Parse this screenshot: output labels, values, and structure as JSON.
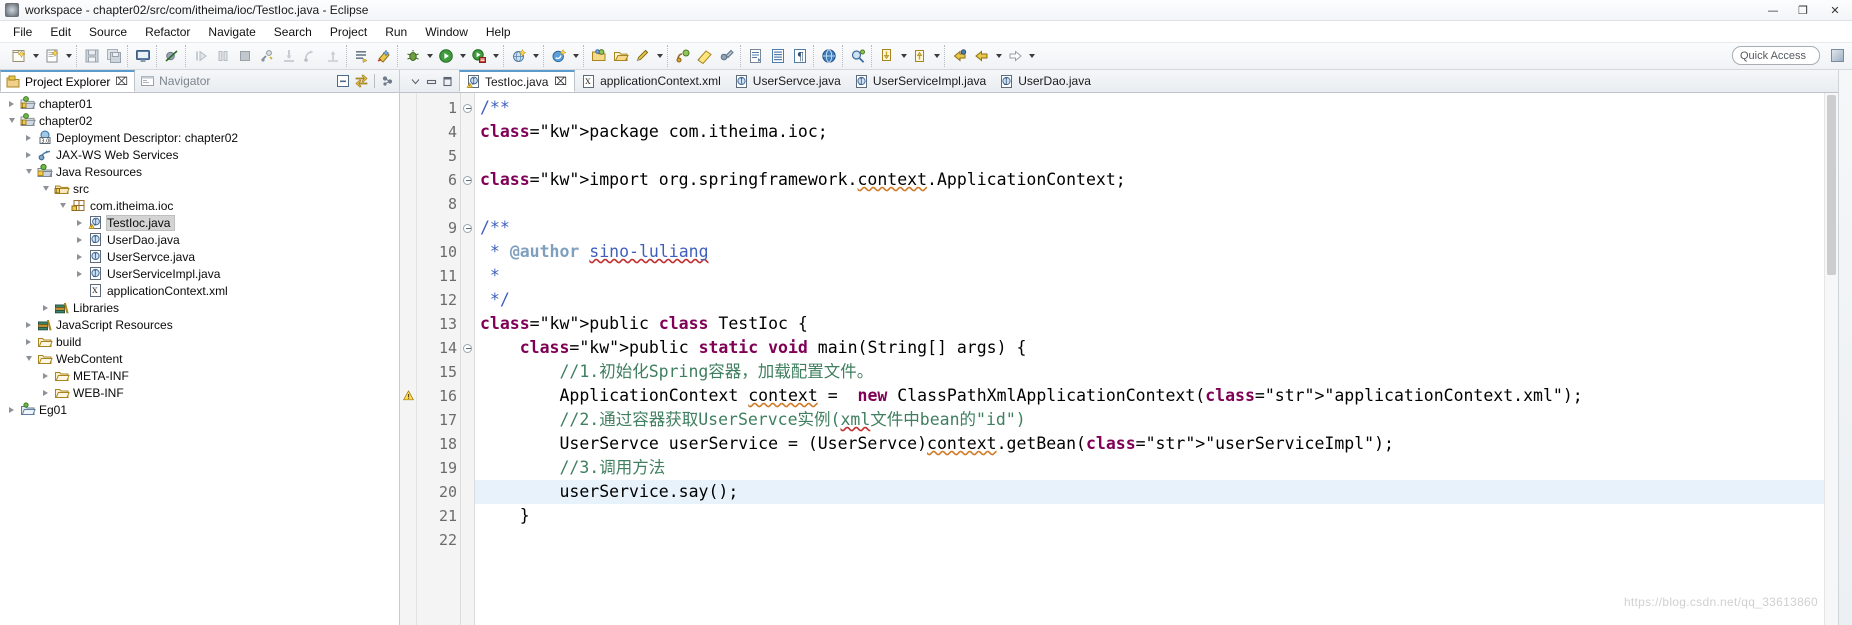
{
  "window": {
    "title": "workspace - chapter02/src/com/itheima/ioc/TestIoc.java - Eclipse",
    "app_icon": "eclipse-icon",
    "minimize": "—",
    "maximize": "❐",
    "close": "✕"
  },
  "menubar": {
    "items": [
      {
        "label": "File"
      },
      {
        "label": "Edit"
      },
      {
        "label": "Source"
      },
      {
        "label": "Refactor"
      },
      {
        "label": "Navigate"
      },
      {
        "label": "Search"
      },
      {
        "label": "Project"
      },
      {
        "label": "Run"
      },
      {
        "label": "Window"
      },
      {
        "label": "Help"
      }
    ]
  },
  "toolbar": {
    "quick_access_placeholder": "Quick Access",
    "groups": [
      {
        "buttons": [
          {
            "name": "new-wizard-icon",
            "arrow": true
          },
          {
            "name": "new-java-class-icon",
            "arrow": true
          }
        ]
      },
      {
        "buttons": [
          {
            "name": "save-icon",
            "arrow": false
          },
          {
            "name": "save-all-icon",
            "arrow": false
          }
        ]
      },
      {
        "buttons": [
          {
            "name": "open-console-icon",
            "arrow": false
          }
        ]
      },
      {
        "buttons": [
          {
            "name": "skip-breakpoints-icon",
            "arrow": false
          }
        ]
      },
      {
        "buttons": [
          {
            "name": "resume-icon",
            "arrow": false
          },
          {
            "name": "suspend-icon",
            "arrow": false
          },
          {
            "name": "terminate-icon",
            "arrow": false
          },
          {
            "name": "disconnect-icon",
            "arrow": false
          },
          {
            "name": "step-into-icon",
            "arrow": false
          },
          {
            "name": "step-over-icon",
            "arrow": false
          },
          {
            "name": "step-return-icon",
            "arrow": false
          }
        ]
      },
      {
        "buttons": [
          {
            "name": "build-all-icon",
            "arrow": false
          },
          {
            "name": "run-last-tool-icon",
            "arrow": false
          }
        ]
      },
      {
        "buttons": [
          {
            "name": "debug-icon",
            "arrow": true
          },
          {
            "name": "run-icon",
            "arrow": true
          },
          {
            "name": "run-as-server-icon",
            "arrow": true
          }
        ]
      },
      {
        "buttons": [
          {
            "name": "new-web-project-icon",
            "arrow": true
          }
        ]
      },
      {
        "buttons": [
          {
            "name": "new-spring-element-icon",
            "arrow": true
          }
        ]
      },
      {
        "buttons": [
          {
            "name": "open-type-icon",
            "arrow": false
          },
          {
            "name": "open-task-icon",
            "arrow": false
          },
          {
            "name": "edit-icon",
            "arrow": true
          }
        ]
      },
      {
        "buttons": [
          {
            "name": "profile-icon",
            "arrow": false
          },
          {
            "name": "coverage-icon",
            "arrow": false
          },
          {
            "name": "external-tools-icon",
            "arrow": false
          }
        ]
      },
      {
        "buttons": [
          {
            "name": "new-xml-file-icon",
            "arrow": false
          },
          {
            "name": "new-text-file-icon",
            "arrow": false
          },
          {
            "name": "paragraph-icon",
            "arrow": false
          }
        ]
      },
      {
        "buttons": [
          {
            "name": "web-browser-icon",
            "arrow": false
          }
        ]
      },
      {
        "buttons": [
          {
            "name": "search-icon",
            "arrow": false
          }
        ]
      },
      {
        "buttons": [
          {
            "name": "next-annotation-icon",
            "arrow": true
          },
          {
            "name": "previous-annotation-icon",
            "arrow": true
          }
        ]
      },
      {
        "buttons": [
          {
            "name": "back-history-icon",
            "arrow": false
          },
          {
            "name": "previous-edit-icon",
            "arrow": true
          },
          {
            "name": "forward-history-icon",
            "arrow": true
          }
        ]
      }
    ]
  },
  "explorer": {
    "tabs": [
      {
        "label": "Project Explorer",
        "icon": "project-explorer-icon",
        "active": true,
        "closable": true
      },
      {
        "label": "Navigator",
        "icon": "navigator-icon",
        "active": false,
        "closable": false
      }
    ],
    "toolbar_icons": [
      "collapse-all-icon",
      "link-with-editor-icon",
      "view-menu-icon"
    ],
    "tree": [
      {
        "label": "chapter01",
        "indent": 0,
        "twisty": "collapsed",
        "icon": "java-web-project-icon",
        "selected": false
      },
      {
        "label": "chapter02",
        "indent": 0,
        "twisty": "expanded",
        "icon": "java-web-project-icon",
        "selected": false
      },
      {
        "label": "Deployment Descriptor: chapter02",
        "indent": 1,
        "twisty": "collapsed",
        "icon": "deployment-descriptor-icon",
        "selected": false
      },
      {
        "label": "JAX-WS Web Services",
        "indent": 1,
        "twisty": "collapsed",
        "icon": "jaxws-icon",
        "selected": false
      },
      {
        "label": "Java Resources",
        "indent": 1,
        "twisty": "expanded",
        "icon": "java-resources-icon",
        "selected": false
      },
      {
        "label": "src",
        "indent": 2,
        "twisty": "expanded",
        "icon": "source-folder-icon",
        "selected": false
      },
      {
        "label": "com.itheima.ioc",
        "indent": 3,
        "twisty": "expanded",
        "icon": "package-icon",
        "selected": false
      },
      {
        "label": "TestIoc.java",
        "indent": 4,
        "twisty": "collapsed",
        "icon": "java-file-warning-icon",
        "selected": true
      },
      {
        "label": "UserDao.java",
        "indent": 4,
        "twisty": "collapsed",
        "icon": "java-file-icon",
        "selected": false
      },
      {
        "label": "UserServce.java",
        "indent": 4,
        "twisty": "collapsed",
        "icon": "java-interface-icon",
        "selected": false
      },
      {
        "label": "UserServiceImpl.java",
        "indent": 4,
        "twisty": "collapsed",
        "icon": "java-file-icon",
        "selected": false
      },
      {
        "label": "applicationContext.xml",
        "indent": 4,
        "twisty": "none",
        "icon": "xml-file-icon",
        "selected": false
      },
      {
        "label": "Libraries",
        "indent": 2,
        "twisty": "collapsed",
        "icon": "library-icon",
        "selected": false
      },
      {
        "label": "JavaScript Resources",
        "indent": 1,
        "twisty": "collapsed",
        "icon": "library-icon",
        "selected": false
      },
      {
        "label": "build",
        "indent": 1,
        "twisty": "collapsed",
        "icon": "folder-icon",
        "selected": false
      },
      {
        "label": "WebContent",
        "indent": 1,
        "twisty": "expanded",
        "icon": "folder-icon",
        "selected": false
      },
      {
        "label": "META-INF",
        "indent": 2,
        "twisty": "collapsed",
        "icon": "folder-icon",
        "selected": false
      },
      {
        "label": "WEB-INF",
        "indent": 2,
        "twisty": "collapsed",
        "icon": "folder-icon",
        "selected": false
      },
      {
        "label": "Eg01",
        "indent": 0,
        "twisty": "collapsed",
        "icon": "project-icon",
        "selected": false
      }
    ]
  },
  "editor": {
    "left_controls": [
      "minimize-view-icon",
      "restore-view-icon",
      "maximize-view-icon"
    ],
    "tabs": [
      {
        "label": "TestIoc.java",
        "icon": "java-file-warning-icon",
        "active": true,
        "closable": true
      },
      {
        "label": "applicationContext.xml",
        "icon": "xml-file-icon",
        "active": false,
        "closable": false
      },
      {
        "label": "UserServce.java",
        "icon": "java-interface-icon",
        "active": false,
        "closable": false
      },
      {
        "label": "UserServiceImpl.java",
        "icon": "java-file-icon",
        "active": false,
        "closable": false
      },
      {
        "label": "UserDao.java",
        "icon": "java-file-icon",
        "active": false,
        "closable": false
      }
    ],
    "watermark": "https://blog.csdn.net/qq_33613860",
    "lines": [
      {
        "num": "1",
        "fold": "minus",
        "marker": "",
        "highlight": false
      },
      {
        "num": "4",
        "fold": "",
        "marker": "",
        "highlight": false
      },
      {
        "num": "5",
        "fold": "",
        "marker": "",
        "highlight": false
      },
      {
        "num": "6",
        "fold": "minus",
        "marker": "",
        "highlight": false
      },
      {
        "num": "8",
        "fold": "",
        "marker": "",
        "highlight": false
      },
      {
        "num": "9",
        "fold": "minus",
        "marker": "",
        "highlight": false
      },
      {
        "num": "10",
        "fold": "",
        "marker": "",
        "highlight": false
      },
      {
        "num": "11",
        "fold": "",
        "marker": "",
        "highlight": false
      },
      {
        "num": "12",
        "fold": "",
        "marker": "",
        "highlight": false
      },
      {
        "num": "13",
        "fold": "",
        "marker": "",
        "highlight": false
      },
      {
        "num": "14",
        "fold": "minus",
        "marker": "",
        "highlight": false
      },
      {
        "num": "15",
        "fold": "",
        "marker": "",
        "highlight": false
      },
      {
        "num": "16",
        "fold": "",
        "marker": "warning",
        "highlight": false
      },
      {
        "num": "17",
        "fold": "",
        "marker": "",
        "highlight": false
      },
      {
        "num": "18",
        "fold": "",
        "marker": "",
        "highlight": false
      },
      {
        "num": "19",
        "fold": "",
        "marker": "",
        "highlight": false
      },
      {
        "num": "20",
        "fold": "",
        "marker": "",
        "highlight": true
      },
      {
        "num": "21",
        "fold": "",
        "marker": "",
        "highlight": false
      },
      {
        "num": "22",
        "fold": "",
        "marker": "",
        "highlight": false
      }
    ],
    "code_text": [
      "/**",
      "package com.itheima.ioc;",
      "",
      "import org.springframework.context.ApplicationContext;",
      "",
      "/**",
      " * @author sino-luliang",
      " *",
      " */",
      "public class TestIoc {",
      "    public static void main(String[] args) {",
      "        //1.初始化Spring容器，加载配置文件。",
      "        ApplicationContext context =  new ClassPathXmlApplicationContext(\"applicationContext.xml\");",
      "        //2.通过容器获取UserServce实例(xml文件中bean的\"id\")",
      "        UserServce userService = (UserServce)context.getBean(\"userServiceImpl\");",
      "        //3.调用方法",
      "        userService.say();",
      "    }",
      ""
    ]
  }
}
